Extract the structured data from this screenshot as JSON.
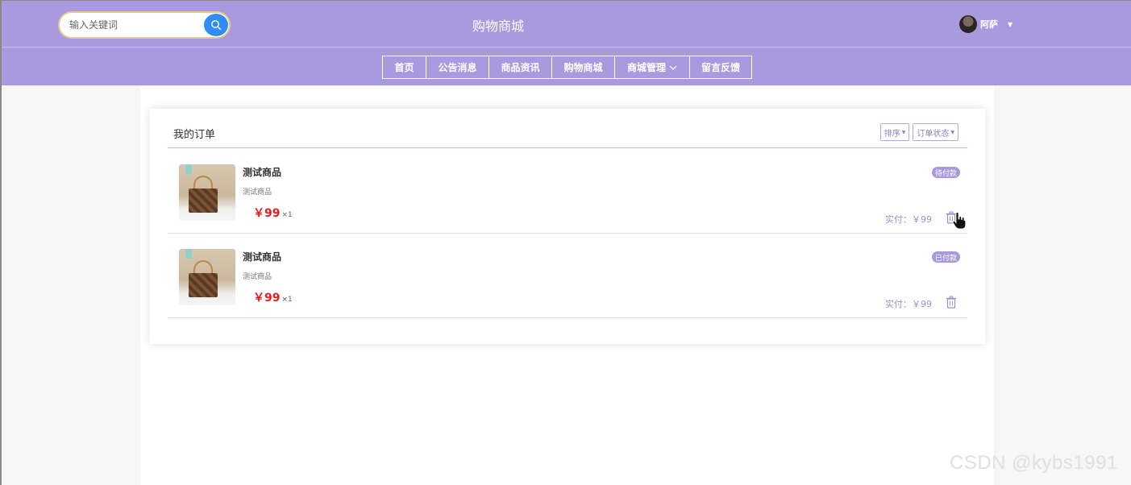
{
  "theme": {
    "brand": "#a99ae0",
    "search_button": "#2f8df5",
    "price": "#e02020"
  },
  "header": {
    "search": {
      "placeholder": "输入关键词",
      "icon": "search-icon"
    },
    "site_title": "购物商城",
    "user": {
      "name": "阿萨",
      "avatar": "avatar-image",
      "caret": "caret-down-icon"
    }
  },
  "nav": {
    "items": [
      {
        "label": "首页"
      },
      {
        "label": "公告消息"
      },
      {
        "label": "商品资讯"
      },
      {
        "label": "购物商城"
      },
      {
        "label": "商城管理",
        "has_dropdown": true
      },
      {
        "label": "留言反馈"
      }
    ]
  },
  "orders_panel": {
    "title": "我的订单",
    "sort_label": "排序",
    "status_filter_label": "订单状态",
    "orders": [
      {
        "name": "测试商品",
        "desc": "测试商品",
        "price": "￥99",
        "qty": "×1",
        "status": "待付款",
        "paid": "实付：￥99"
      },
      {
        "name": "测试商品",
        "desc": "测试商品",
        "price": "￥99",
        "qty": "×1",
        "status": "已付款",
        "paid": "实付：￥99"
      }
    ]
  },
  "watermark": "CSDN @kybs1991"
}
